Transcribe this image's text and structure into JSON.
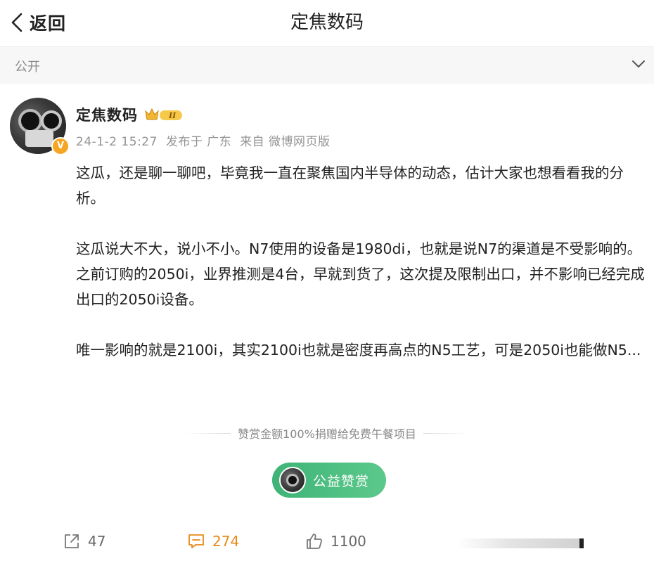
{
  "header": {
    "back_label": "返回",
    "title": "定焦数码"
  },
  "visibility": {
    "label": "公开"
  },
  "post": {
    "author": "定焦数码",
    "verified_badge": "V",
    "rank_badge_text": "II",
    "meta": {
      "timestamp": "24-1-2 15:27",
      "location": "发布于 广东",
      "source": "来自 微博网页版"
    },
    "paragraphs": [
      "这瓜，还是聊一聊吧，毕竟我一直在聚焦国内半导体的动态，估计大家也想看看我的分析。",
      "这瓜说大不大，说小不小。N7使用的设备是1980di，也就是说N7的渠道是不受影响的。之前订购的2050i，业界推测是4台，早就到货了，这次提及限制出口，并不影响已经完成出口的2050i设备。",
      "唯一影响的就是2100i，其实2100i也就是密度再高点的N5工艺，可是2050i也能做N5..."
    ]
  },
  "reward": {
    "note": "赞赏金额100%捐赠给免费午餐项目",
    "button_label": "公益赞赏",
    "color": "#4cbd80"
  },
  "actions": {
    "share_count": "47",
    "comment_count": "274",
    "like_count": "1100",
    "comment_color": "#e88a1a"
  }
}
